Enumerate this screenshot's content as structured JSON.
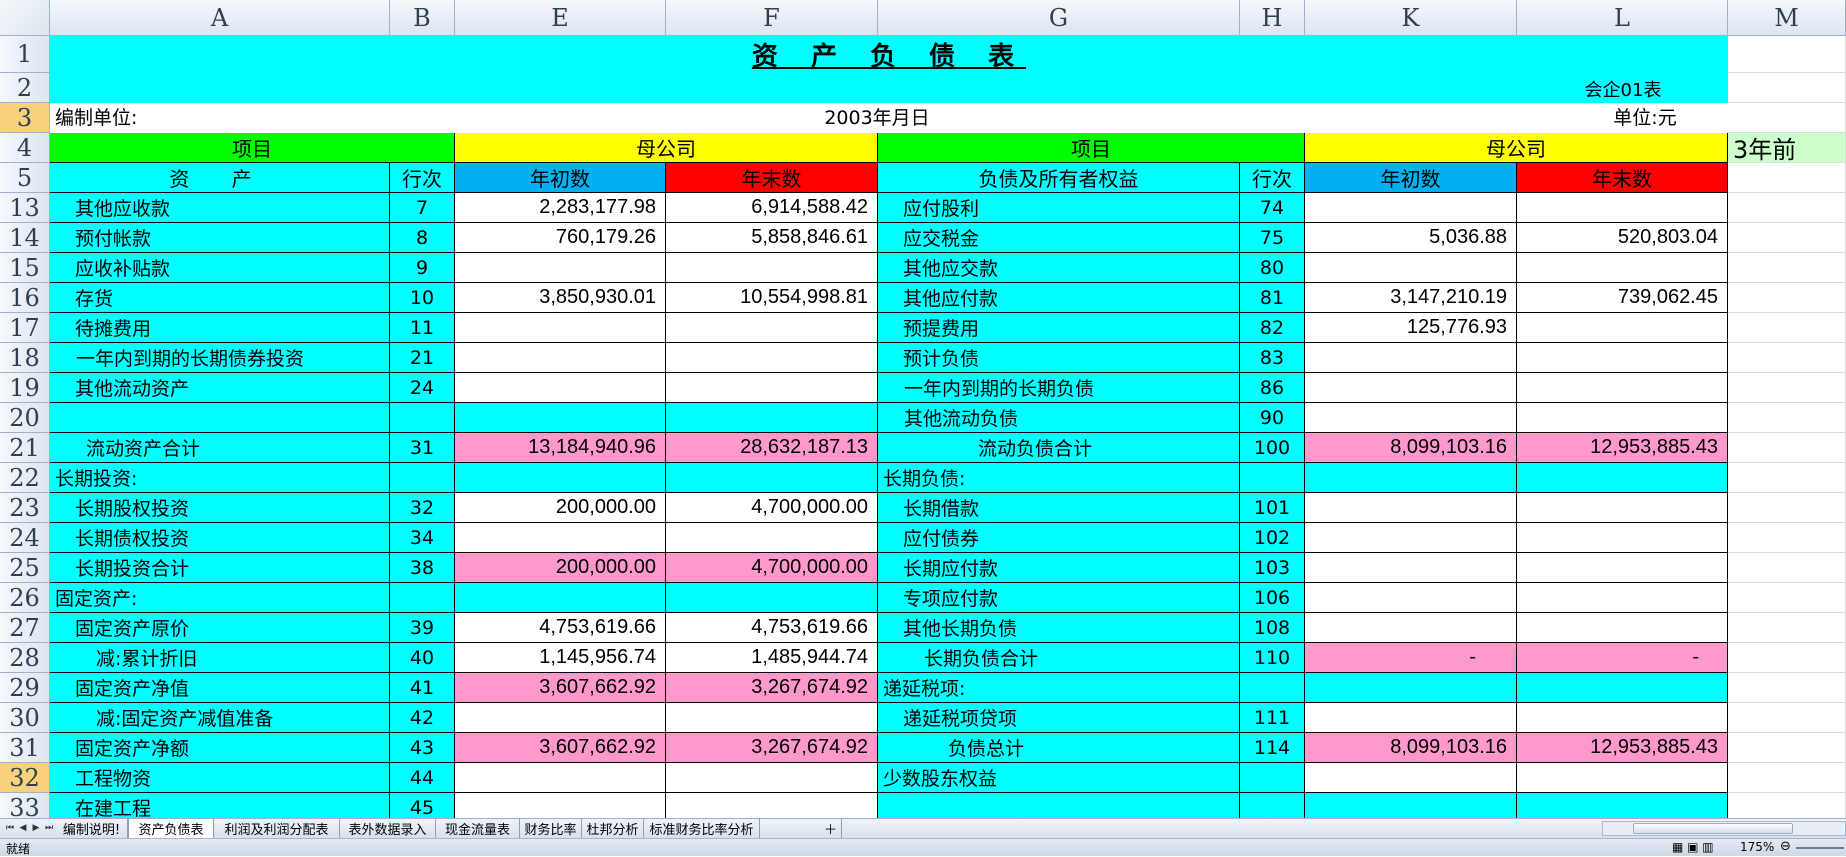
{
  "columns": [
    "A",
    "B",
    "E",
    "F",
    "G",
    "H",
    "K",
    "L",
    "M"
  ],
  "header": {
    "title": "资 产 负 债 表",
    "form_no": "会企01表",
    "unit_label": "编制单位:",
    "date": "2003年月日",
    "currency": "单位:元"
  },
  "group_row": {
    "item": "项目",
    "parent": "母公司",
    "item2": "项目",
    "parent2": "母公司",
    "side_note": "3年前"
  },
  "col_row": {
    "assets": "资 产",
    "line": "行次",
    "begin": "年初数",
    "end": "年末数",
    "liab": "负债及所有者权益",
    "line2": "行次",
    "begin2": "年初数",
    "end2": "年末数"
  },
  "rows": [
    {
      "rn": "13",
      "a": "其他应收款",
      "b": "7",
      "e": "2,283,177.98",
      "f": "6,914,588.42",
      "g": "应付股利",
      "h": "74",
      "k": "",
      "l": ""
    },
    {
      "rn": "14",
      "a": "预付帐款",
      "b": "8",
      "e": "760,179.26",
      "f": "5,858,846.61",
      "g": "应交税金",
      "h": "75",
      "k": "5,036.88",
      "l": "520,803.04"
    },
    {
      "rn": "15",
      "a": "应收补贴款",
      "b": "9",
      "e": "",
      "f": "",
      "g": "其他应交款",
      "h": "80",
      "k": "",
      "l": ""
    },
    {
      "rn": "16",
      "a": "存货",
      "b": "10",
      "e": "3,850,930.01",
      "f": "10,554,998.81",
      "g": "其他应付款",
      "h": "81",
      "k": "3,147,210.19",
      "l": "739,062.45"
    },
    {
      "rn": "17",
      "a": "待摊费用",
      "b": "11",
      "e": "",
      "f": "",
      "g": "预提费用",
      "h": "82",
      "k": "125,776.93",
      "l": ""
    },
    {
      "rn": "18",
      "a": "一年内到期的长期债券投资",
      "b": "21",
      "e": "",
      "f": "",
      "g": "预计负债",
      "h": "83",
      "k": "",
      "l": ""
    },
    {
      "rn": "19",
      "a": "其他流动资产",
      "b": "24",
      "e": "",
      "f": "",
      "g": "一年内到期的长期负债",
      "h": "86",
      "k": "",
      "l": ""
    },
    {
      "rn": "20",
      "a": "",
      "b": "",
      "e": "",
      "f": "",
      "g": "其他流动负债",
      "h": "90",
      "k": "",
      "l": ""
    },
    {
      "rn": "21",
      "a": "流动资产合计",
      "b": "31",
      "e": "13,184,940.96",
      "f": "28,632,187.13",
      "g": "流动负债合计",
      "h": "100",
      "k": "8,099,103.16",
      "l": "12,953,885.43"
    },
    {
      "rn": "22",
      "a": "长期投资:",
      "b": "",
      "e": "",
      "f": "",
      "g": "长期负债:",
      "h": "",
      "k": "",
      "l": ""
    },
    {
      "rn": "23",
      "a": "长期股权投资",
      "b": "32",
      "e": "200,000.00",
      "f": "4,700,000.00",
      "g": "长期借款",
      "h": "101",
      "k": "",
      "l": ""
    },
    {
      "rn": "24",
      "a": "长期债权投资",
      "b": "34",
      "e": "",
      "f": "",
      "g": "应付债券",
      "h": "102",
      "k": "",
      "l": ""
    },
    {
      "rn": "25",
      "a": "长期投资合计",
      "b": "38",
      "e": "200,000.00",
      "f": "4,700,000.00",
      "g": "长期应付款",
      "h": "103",
      "k": "",
      "l": ""
    },
    {
      "rn": "26",
      "a": "固定资产:",
      "b": "",
      "e": "",
      "f": "",
      "g": "专项应付款",
      "h": "106",
      "k": "",
      "l": ""
    },
    {
      "rn": "27",
      "a": "固定资产原价",
      "b": "39",
      "e": "4,753,619.66",
      "f": "4,753,619.66",
      "g": "其他长期负债",
      "h": "108",
      "k": "",
      "l": ""
    },
    {
      "rn": "28",
      "a": "减:累计折旧",
      "b": "40",
      "e": "1,145,956.74",
      "f": "1,485,944.74",
      "g": "长期负债合计",
      "h": "110",
      "k": "-",
      "l": "-"
    },
    {
      "rn": "29",
      "a": "固定资产净值",
      "b": "41",
      "e": "3,607,662.92",
      "f": "3,267,674.92",
      "g": "递延税项:",
      "h": "",
      "k": "",
      "l": ""
    },
    {
      "rn": "30",
      "a": "减:固定资产减值准备",
      "b": "42",
      "e": "",
      "f": "",
      "g": "递延税项贷项",
      "h": "111",
      "k": "",
      "l": ""
    },
    {
      "rn": "31",
      "a": "固定资产净额",
      "b": "43",
      "e": "3,607,662.92",
      "f": "3,267,674.92",
      "g": "负债总计",
      "h": "114",
      "k": "8,099,103.16",
      "l": "12,953,885.43"
    },
    {
      "rn": "32",
      "a": "工程物资",
      "b": "44",
      "e": "",
      "f": "",
      "g": "少数股东权益",
      "h": "",
      "k": "",
      "l": ""
    },
    {
      "rn": "33",
      "a": "在建工程",
      "b": "45",
      "e": "",
      "f": "",
      "g": "",
      "h": "",
      "k": "",
      "l": ""
    }
  ],
  "sheet_tabs": [
    "编制说明!",
    "资产负债表",
    "利润及利润分配表",
    "表外数据录入",
    "现金流量表",
    "财务比率",
    "杜邦分析",
    "标准财务比率分析"
  ],
  "active_tab": "资产负债表",
  "status": {
    "ready": "就绪",
    "zoom": "175%"
  },
  "colors": {
    "cyan": "#00ffff",
    "green": "#00ff00",
    "yellow": "#ffff00",
    "blue_header": "#00b0f0",
    "red_header": "#ff0000",
    "pink_total": "#ff99cc",
    "side_note_bg": "#ccffcc",
    "white": "#ffffff",
    "row_header_selected": "#f8d27a"
  }
}
